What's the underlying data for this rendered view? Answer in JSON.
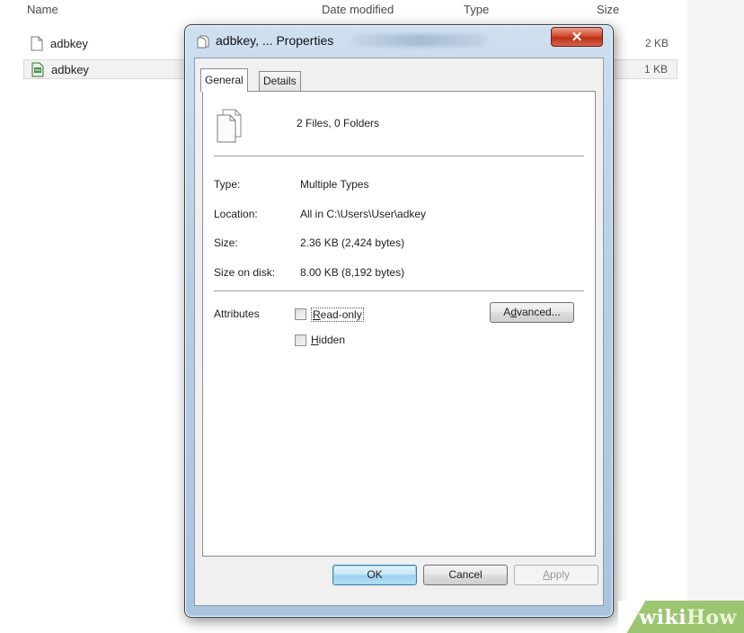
{
  "explorer": {
    "columns": {
      "name": "Name",
      "date": "Date modified",
      "type": "Type",
      "size": "Size"
    },
    "files": [
      {
        "name": "adbkey",
        "size": "2 KB",
        "icon": "document-icon"
      },
      {
        "name": "adbkey",
        "size": "1 KB",
        "icon": "script-file-icon"
      }
    ]
  },
  "dialog": {
    "title": "adbkey, ... Properties",
    "close_label": "✕",
    "tabs": [
      "General",
      "Details"
    ],
    "active_tab": "General",
    "summary": "2 Files, 0 Folders",
    "properties": [
      {
        "label": "Type:",
        "value": "Multiple Types"
      },
      {
        "label": "Location:",
        "value": "All in C:\\Users\\User\\adkey"
      },
      {
        "label": "Size:",
        "value": "2.36 KB (2,424 bytes)"
      },
      {
        "label": "Size on disk:",
        "value": "8.00 KB (8,192 bytes)"
      }
    ],
    "attributes": {
      "label": "Attributes",
      "readonly": {
        "pre": "",
        "accel": "R",
        "post": "ead-only",
        "checked": "indeterminate"
      },
      "hidden": {
        "pre": "",
        "accel": "H",
        "post": "idden",
        "checked": "indeterminate"
      },
      "advanced": {
        "pre": "A",
        "accel": "d",
        "post": "vanced..."
      }
    },
    "buttons": {
      "ok": "OK",
      "cancel": "Cancel",
      "apply": {
        "accel": "A",
        "post": "pply"
      }
    }
  },
  "watermark": {
    "wiki": "wiki",
    "how": "How"
  },
  "colors": {
    "accent": "#3c7fb1",
    "close": "#cf4b30",
    "watermark": "#9cc572"
  }
}
